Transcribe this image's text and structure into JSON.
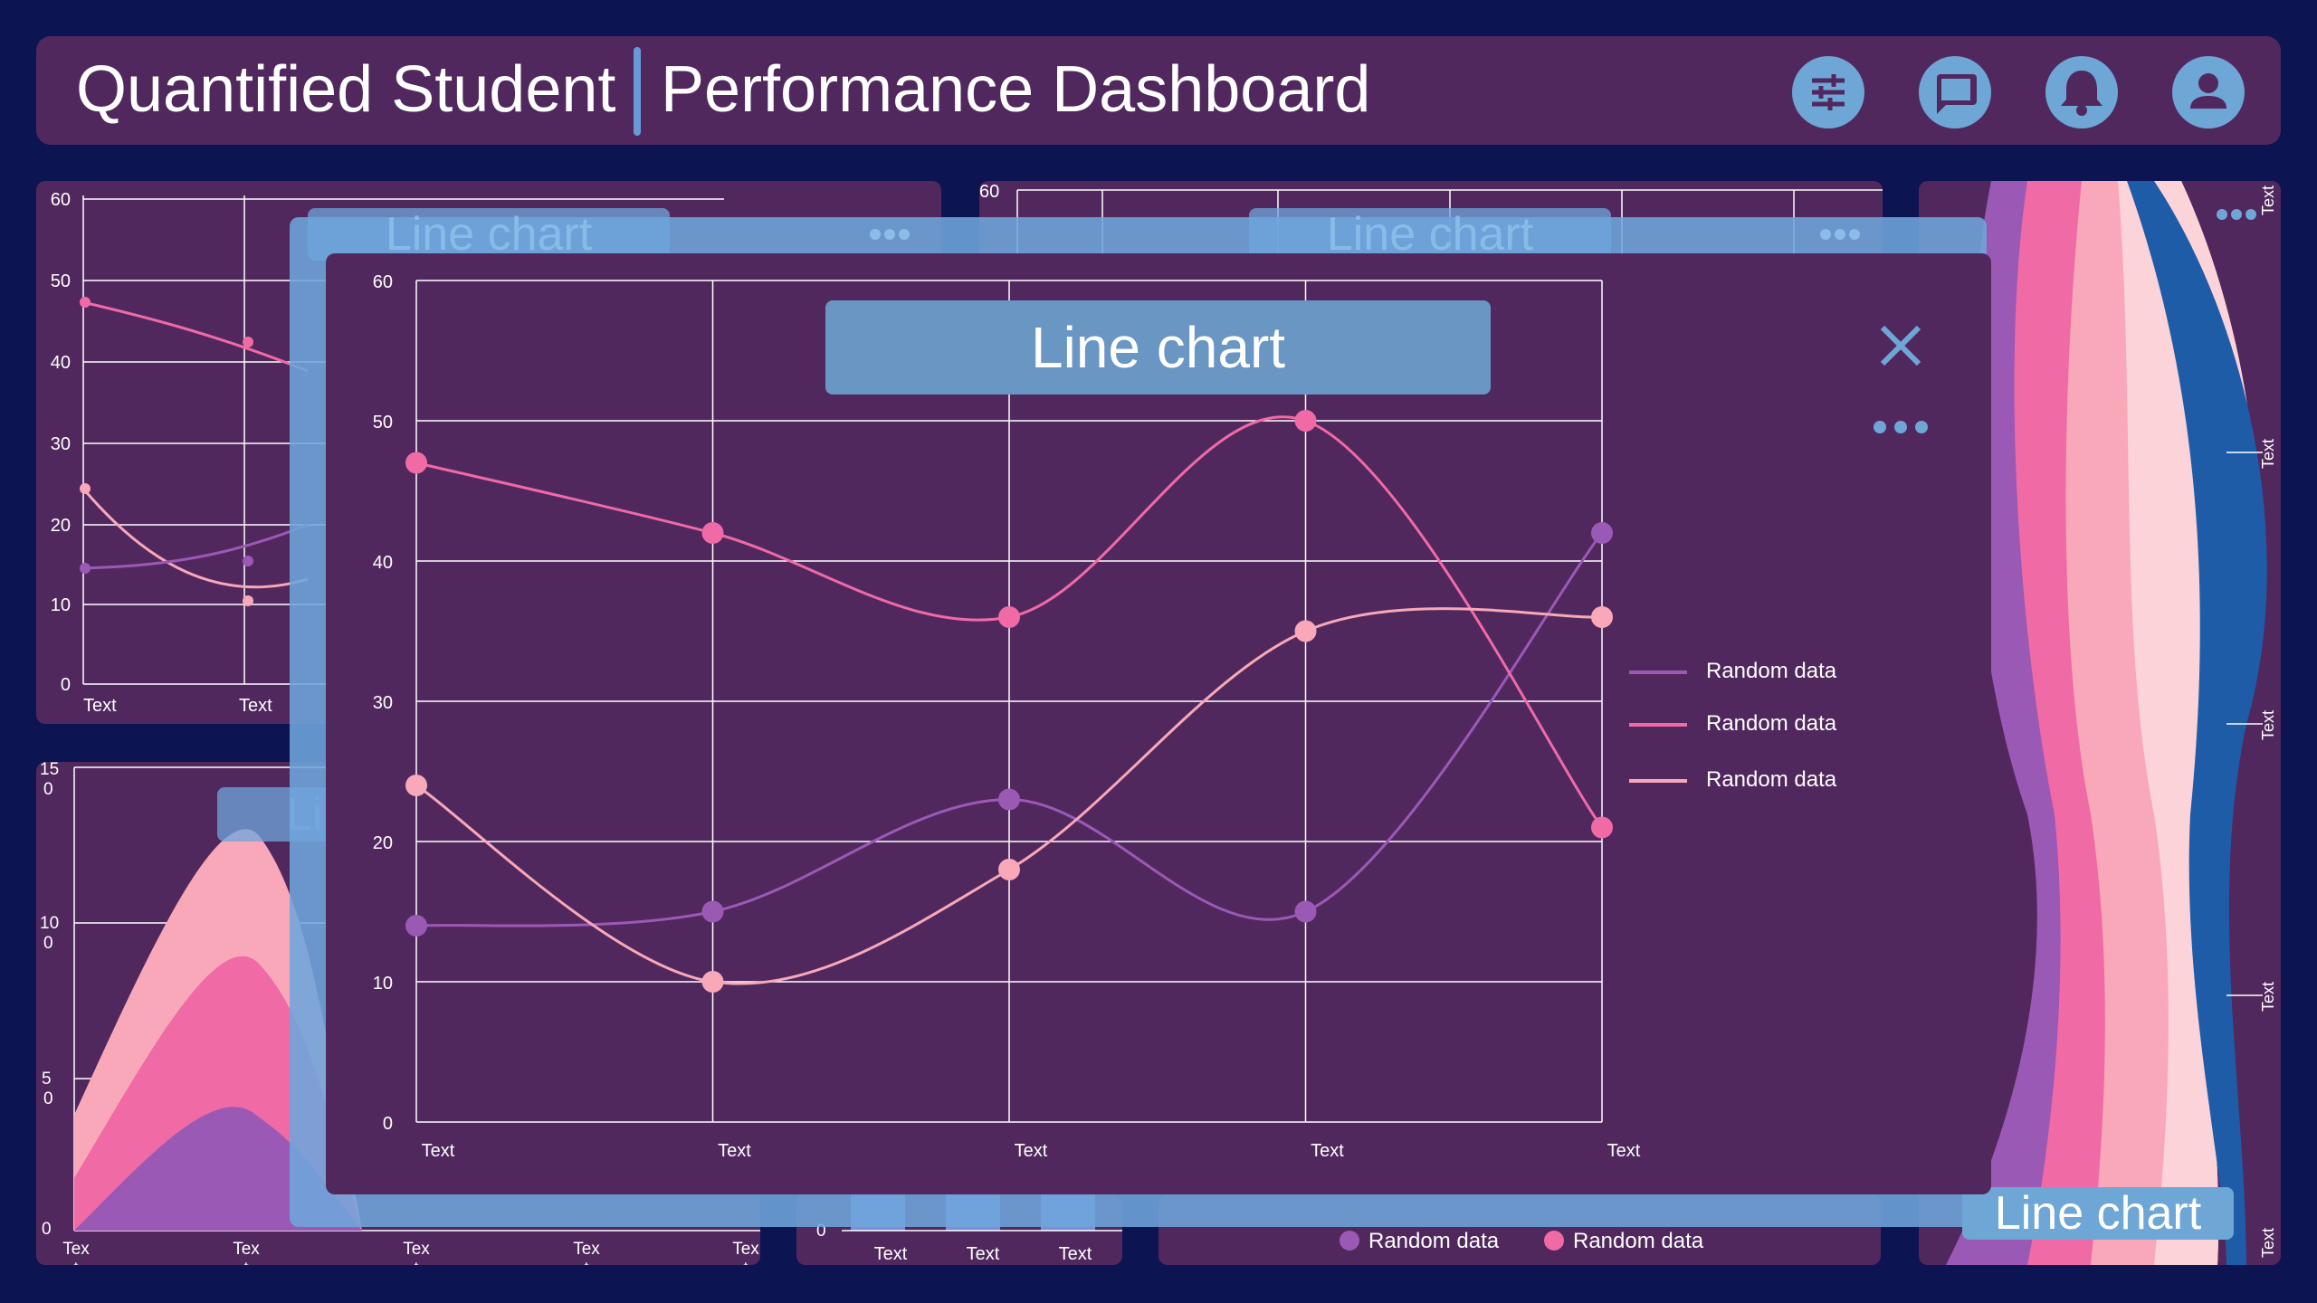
{
  "header": {
    "app_title": "Quantified Student",
    "page_title": "Performance Dashboard",
    "icons": [
      "sliders-icon",
      "chat-icon",
      "bell-icon",
      "user-icon"
    ]
  },
  "colors": {
    "background": "#0c1452",
    "panel": "#51285e",
    "accent": "#6ea6d6",
    "series_purple": "#9b59b6",
    "series_pink": "#f06aa6",
    "series_light_pink": "#f8a8b8",
    "series_blue": "#1f5ca8"
  },
  "modal": {
    "title": "Line chart",
    "close_icon": "close-icon",
    "more_icon": "more-icon"
  },
  "background_widgets": {
    "top_left_ylabels": [
      "0",
      "10",
      "20",
      "30",
      "40",
      "50",
      "60"
    ],
    "top_left_xlabels": [
      "Text",
      "Text"
    ],
    "top_middle_ylabel": "60",
    "top_middle_title": "Line chart",
    "area_chart_ylabels": [
      "0",
      "5\n0",
      "10\n0",
      "15\n0"
    ],
    "area_chart_xlabels": [
      "Tex\nt",
      "Tex\nt",
      "Tex\nt",
      "Tex\nt",
      "Tex\nt"
    ],
    "area_chart_title": "Li",
    "bar_chart_xlabels": [
      "Text",
      "Text",
      "Text"
    ],
    "bar_chart_ylabel": "0",
    "bottom_legend": [
      "Random data",
      "Random data"
    ],
    "stream_chart_title": "Line chart",
    "stream_chart_labels": [
      "Text",
      "Text",
      "Text",
      "Text",
      "Text"
    ]
  },
  "chart_data": {
    "type": "line",
    "title": "Line chart",
    "categories": [
      "Text",
      "Text",
      "Text",
      "Text",
      "Text"
    ],
    "ylim": [
      0,
      60
    ],
    "yticks": [
      0,
      10,
      20,
      30,
      40,
      50,
      60
    ],
    "grid": true,
    "legend_position": "right",
    "series": [
      {
        "name": "Random data",
        "color": "#9b59b6",
        "values": [
          14,
          15,
          23,
          15,
          42
        ]
      },
      {
        "name": "Random data",
        "color": "#f06aa6",
        "values": [
          47,
          42,
          36,
          50,
          21
        ]
      },
      {
        "name": "Random data",
        "color": "#f8a8b8",
        "values": [
          24,
          10,
          18,
          35,
          36
        ]
      }
    ]
  }
}
